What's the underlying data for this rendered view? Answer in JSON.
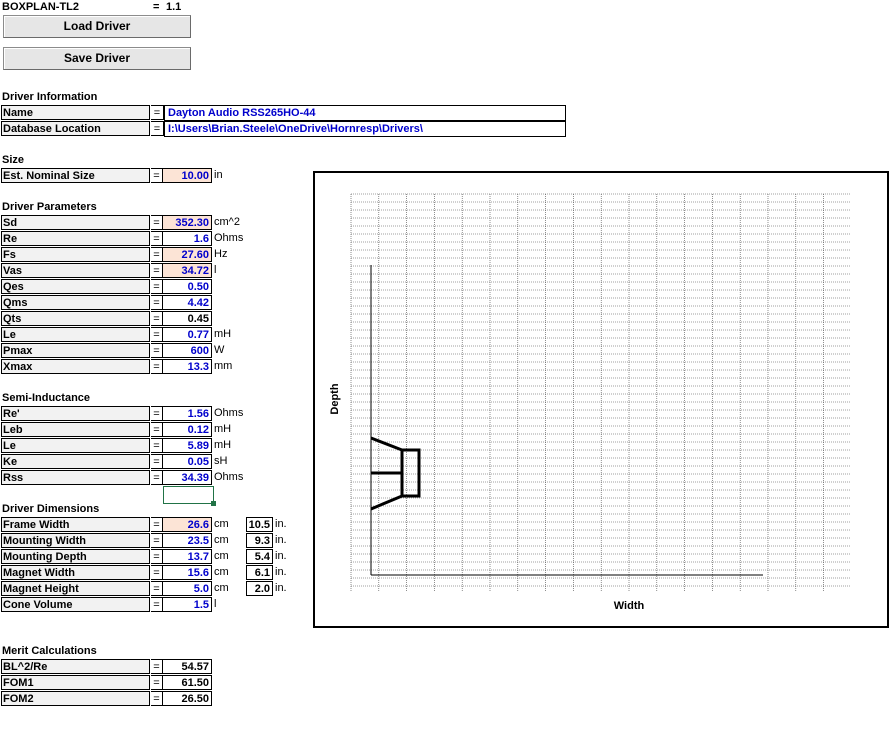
{
  "sheet": {
    "title": "BOXPLAN-TL2",
    "version_eq": "=",
    "version": "1.1"
  },
  "buttons": {
    "load": "Load Driver",
    "save": "Save Driver"
  },
  "eq": "=",
  "driver_info": {
    "heading": "Driver Information",
    "rows": [
      {
        "label": "Name",
        "value": "Dayton Audio RSS265HO-44"
      },
      {
        "label": "Database Location",
        "value": "I:\\Users\\Brian.Steele\\OneDrive\\Hornresp\\Drivers\\"
      }
    ]
  },
  "size": {
    "heading": "Size",
    "rows": [
      {
        "label": "Est. Nominal Size",
        "value": "10.00",
        "unit": "in"
      }
    ]
  },
  "driver_params": {
    "heading": "Driver Parameters",
    "rows": [
      {
        "label": "Sd",
        "value": "352.30",
        "unit": "cm^2"
      },
      {
        "label": "Re",
        "value": "1.6",
        "unit": "Ohms"
      },
      {
        "label": "Fs",
        "value": "27.60",
        "unit": "Hz"
      },
      {
        "label": "Vas",
        "value": "34.72",
        "unit": "l"
      },
      {
        "label": "Qes",
        "value": "0.50",
        "unit": ""
      },
      {
        "label": "Qms",
        "value": "4.42",
        "unit": ""
      },
      {
        "label": "Qts",
        "value": "0.45",
        "unit": ""
      },
      {
        "label": "Le",
        "value": "0.77",
        "unit": "mH"
      },
      {
        "label": "Pmax",
        "value": "600",
        "unit": "W"
      },
      {
        "label": "Xmax",
        "value": "13.3",
        "unit": "mm"
      }
    ]
  },
  "semi_inductance": {
    "heading": "Semi-Inductance",
    "rows": [
      {
        "label": "Re'",
        "value": "1.56",
        "unit": "Ohms"
      },
      {
        "label": "Leb",
        "value": "0.12",
        "unit": "mH"
      },
      {
        "label": "Le",
        "value": "5.89",
        "unit": "mH"
      },
      {
        "label": "Ke",
        "value": "0.05",
        "unit": "sH"
      },
      {
        "label": "Rss",
        "value": "34.39",
        "unit": "Ohms"
      }
    ]
  },
  "driver_dims": {
    "heading": "Driver Dimensions",
    "rows": [
      {
        "label": "Frame Width",
        "value": "26.6",
        "unit": "cm",
        "inches": "10.5",
        "in_unit": "in."
      },
      {
        "label": "Mounting Width",
        "value": "23.5",
        "unit": "cm",
        "inches": "9.3",
        "in_unit": "in."
      },
      {
        "label": "Mounting Depth",
        "value": "13.7",
        "unit": "cm",
        "inches": "5.4",
        "in_unit": "in."
      },
      {
        "label": "Magnet Width",
        "value": "15.6",
        "unit": "cm",
        "inches": "6.1",
        "in_unit": "in."
      },
      {
        "label": "Magnet Height",
        "value": "5.0",
        "unit": "cm",
        "inches": "2.0",
        "in_unit": "in."
      },
      {
        "label": "Cone Volume",
        "value": "1.5",
        "unit": "l"
      }
    ]
  },
  "merit": {
    "heading": "Merit Calculations",
    "rows": [
      {
        "label": "BL^2/Re",
        "value": "54.57"
      },
      {
        "label": "FOM1",
        "value": "61.50"
      },
      {
        "label": "FOM2",
        "value": "26.50"
      }
    ]
  },
  "chart_data": {
    "type": "diagram",
    "xlabel": "Width",
    "ylabel": "Depth",
    "grid": true
  }
}
